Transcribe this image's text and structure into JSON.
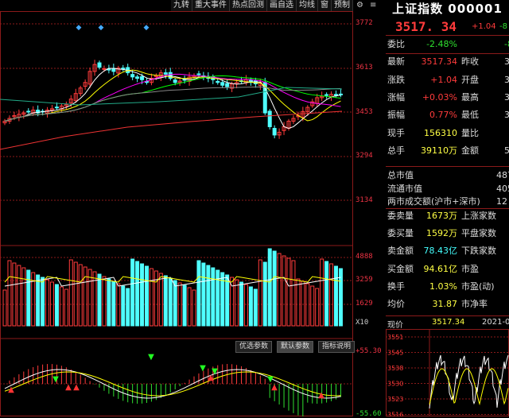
{
  "toolbar": {
    "items": [
      "九转",
      "重大事件",
      "热点回测",
      "画自选",
      "均线",
      "窗",
      "预制"
    ],
    "settings_icon": "gear-icon",
    "extra_icon": "menu-icon"
  },
  "axes": {
    "price_ticks": [
      "3772",
      "3613",
      "3453",
      "3294",
      "3134"
    ],
    "volume_ticks": [
      "4888",
      "3259",
      "1629"
    ],
    "volume_unit": "X10",
    "macd_ticks": [
      "+55.30",
      "-55.60"
    ]
  },
  "sub_tabs": [
    "优选参数",
    "默认参数",
    "指标说明"
  ],
  "header": {
    "title": "上证指数 000001",
    "price": "3517. 34",
    "change": "+1.04",
    "change_right": "-8"
  },
  "quotes": [
    {
      "label": "委比",
      "value": "-2.48%",
      "value_color": "green",
      "label2": "",
      "value2": "-8"
    },
    {
      "label": "最新",
      "value": "3517.34",
      "value_color": "red",
      "label2": "昨收",
      "value2": "35"
    },
    {
      "label": "涨跌",
      "value": "+1.04",
      "value_color": "red",
      "label2": "开盘",
      "value2": "35"
    },
    {
      "label": "涨幅",
      "value": "+0.03%",
      "value_color": "red",
      "label2": "最高",
      "value2": "35"
    },
    {
      "label": "振幅",
      "value": "0.77%",
      "value_color": "red",
      "label2": "最低",
      "value2": "35"
    },
    {
      "label": "现手",
      "value": "156310",
      "value_color": "yellow",
      "label2": "量比",
      "value2": ""
    },
    {
      "label": "总手",
      "value": "39110万",
      "value_color": "yellow",
      "label2": "金额",
      "value2": "5"
    }
  ],
  "market": [
    {
      "label": "总市值",
      "value": "487"
    },
    {
      "label": "流通市值",
      "value": "405"
    },
    {
      "label": "两市成交额(沪市+深市)",
      "value": "12"
    }
  ],
  "breadth": [
    {
      "label": "委卖量",
      "value": "1673万",
      "value_color": "yellow",
      "label2": "上涨家数"
    },
    {
      "label": "委买量",
      "value": "1592万",
      "value_color": "yellow",
      "label2": "平盘家数"
    },
    {
      "label": "卖金额",
      "value": "78.43亿",
      "value_color": "cyan",
      "label2": "下跌家数"
    },
    {
      "label": "买金额",
      "value": "94.61亿",
      "value_color": "yellow",
      "label2": "市盈"
    },
    {
      "label": "换手",
      "value": "1.03%",
      "value_color": "yellow",
      "label2": "市盈(动)"
    },
    {
      "label": "均价",
      "value": "31.87",
      "value_color": "yellow",
      "label2": "市净率"
    }
  ],
  "mini": {
    "label": "现价",
    "value": "3517.34",
    "date": "2021-08",
    "ticks": [
      "3551",
      "3545",
      "3538",
      "3530",
      "3523",
      "3516"
    ]
  },
  "colors": {
    "up": "#ff3b3b",
    "down": "#4fffff",
    "grid": "#8b1a1a"
  }
}
